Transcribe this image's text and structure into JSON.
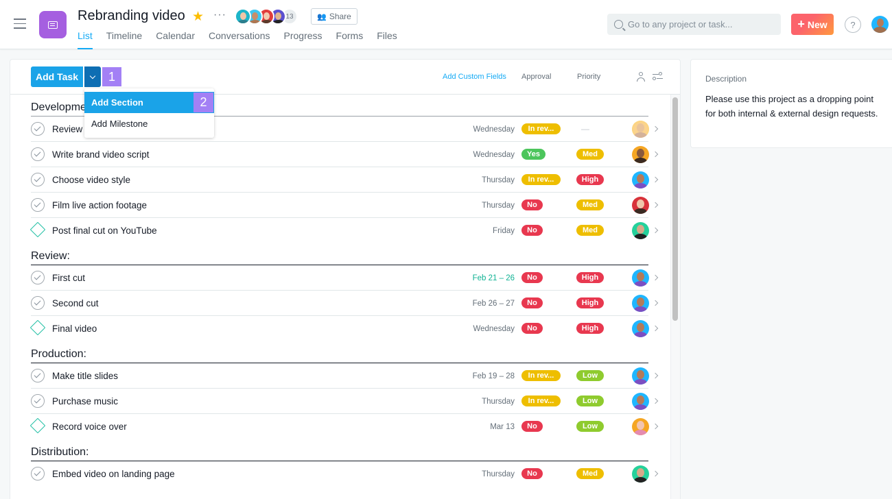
{
  "project": {
    "title": "Rebranding video",
    "member_count": "13",
    "share_label": "Share",
    "brand_color": "#a55fe0"
  },
  "tabs": [
    {
      "label": "List",
      "active": true
    },
    {
      "label": "Timeline"
    },
    {
      "label": "Calendar"
    },
    {
      "label": "Conversations"
    },
    {
      "label": "Progress"
    },
    {
      "label": "Forms"
    },
    {
      "label": "Files"
    }
  ],
  "search": {
    "placeholder": "Go to any project or task..."
  },
  "new_button": {
    "label": "New"
  },
  "help": {
    "label": "?"
  },
  "toolbar": {
    "add_task_label": "Add Task",
    "add_custom_fields": "Add Custom Fields",
    "col_approval": "Approval",
    "col_priority": "Priority"
  },
  "dropdown": {
    "items": [
      {
        "label": "Add Section",
        "highlighted": true
      },
      {
        "label": "Add Milestone"
      }
    ]
  },
  "step_badges": [
    "1",
    "2"
  ],
  "sections": [
    {
      "name": "Development:",
      "tasks": [
        {
          "name": "Review",
          "type": "task",
          "due": "Wednesday",
          "approval": "In rev...",
          "priority": "—"
        },
        {
          "name": "Write brand video script",
          "type": "task",
          "due": "Wednesday",
          "approval": "Yes",
          "priority": "Med"
        },
        {
          "name": "Choose video style",
          "type": "task",
          "due": "Thursday",
          "approval": "In rev...",
          "priority": "High"
        },
        {
          "name": "Film live action footage",
          "type": "task",
          "due": "Thursday",
          "approval": "No",
          "priority": "Med"
        },
        {
          "name": "Post final cut on YouTube",
          "type": "milestone",
          "due": "Friday",
          "approval": "No",
          "priority": "Med"
        }
      ]
    },
    {
      "name": "Review:",
      "tasks": [
        {
          "name": "First cut",
          "type": "task",
          "due": "Feb 21 – 26",
          "due_highlight": true,
          "approval": "No",
          "priority": "High"
        },
        {
          "name": "Second cut",
          "type": "task",
          "due": "Feb 26 – 27",
          "approval": "No",
          "priority": "High"
        },
        {
          "name": "Final video",
          "type": "milestone",
          "due": "Wednesday",
          "approval": "No",
          "priority": "High"
        }
      ]
    },
    {
      "name": "Production:",
      "tasks": [
        {
          "name": "Make title slides",
          "type": "task",
          "due": "Feb 19 – 28",
          "approval": "In rev...",
          "priority": "Low"
        },
        {
          "name": "Purchase music",
          "type": "task",
          "due": "Thursday",
          "approval": "In rev...",
          "priority": "Low"
        },
        {
          "name": "Record voice over",
          "type": "milestone",
          "due": "Mar 13",
          "approval": "No",
          "priority": "Low"
        }
      ]
    },
    {
      "name": "Distribution:",
      "tasks": [
        {
          "name": "Embed video on landing page",
          "type": "task",
          "due": "Thursday",
          "approval": "No",
          "priority": "Med"
        }
      ]
    }
  ],
  "colors": {
    "yes": "#4cc55c",
    "no": "#e8384f",
    "in_review": "#eebe00",
    "high": "#e8384f",
    "med": "#eebe00",
    "low": "#8fcb2e",
    "accent": "#14aaf5",
    "milestone": "#25c1a6",
    "step_badge": "#a380f5"
  },
  "description": {
    "label": "Description",
    "text": "Please use this project as a dropping point for both internal & external design requests."
  }
}
